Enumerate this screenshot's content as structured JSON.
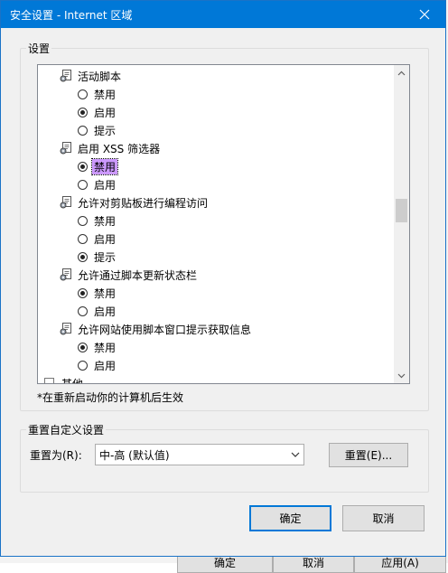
{
  "window": {
    "title": "安全设置 - Internet 区域"
  },
  "settings_group": {
    "label": "设置"
  },
  "list": {
    "rows": [
      {
        "kind": "category",
        "text": "活动脚本",
        "partial": false
      },
      {
        "kind": "option",
        "text": "禁用",
        "checked": false,
        "selected": false
      },
      {
        "kind": "option",
        "text": "启用",
        "checked": true,
        "selected": false
      },
      {
        "kind": "option",
        "text": "提示",
        "checked": false,
        "selected": false
      },
      {
        "kind": "category",
        "text": "启用 XSS 筛选器",
        "partial": false
      },
      {
        "kind": "option",
        "text": "禁用",
        "checked": true,
        "selected": true
      },
      {
        "kind": "option",
        "text": "启用",
        "checked": false,
        "selected": false
      },
      {
        "kind": "category",
        "text": "允许对剪贴板进行编程访问",
        "partial": false
      },
      {
        "kind": "option",
        "text": "禁用",
        "checked": false,
        "selected": false
      },
      {
        "kind": "option",
        "text": "启用",
        "checked": false,
        "selected": false
      },
      {
        "kind": "option",
        "text": "提示",
        "checked": true,
        "selected": false
      },
      {
        "kind": "category",
        "text": "允许通过脚本更新状态栏",
        "partial": false
      },
      {
        "kind": "option",
        "text": "禁用",
        "checked": true,
        "selected": false
      },
      {
        "kind": "option",
        "text": "启用",
        "checked": false,
        "selected": false
      },
      {
        "kind": "category",
        "text": "允许网站使用脚本窗口提示获取信息",
        "partial": false
      },
      {
        "kind": "option",
        "text": "禁用",
        "checked": true,
        "selected": false
      },
      {
        "kind": "option",
        "text": "启用",
        "checked": false,
        "selected": false
      },
      {
        "kind": "category",
        "text": "其他",
        "partial": true
      }
    ]
  },
  "note": "*在重新启动你的计算机后生效",
  "reset_group": {
    "label": "重置自定义设置",
    "reset_to_label": "重置为(R):",
    "combo_value": "中-高 (默认值)",
    "reset_button": "重置(E)..."
  },
  "footer": {
    "ok": "确定",
    "cancel": "取消"
  },
  "parent_buttons": [
    "确定",
    "取消",
    "应用(A)"
  ],
  "colors": {
    "titlebar": "#0078d7",
    "selection": "#cc99ff",
    "default_border": "#0078d7"
  }
}
